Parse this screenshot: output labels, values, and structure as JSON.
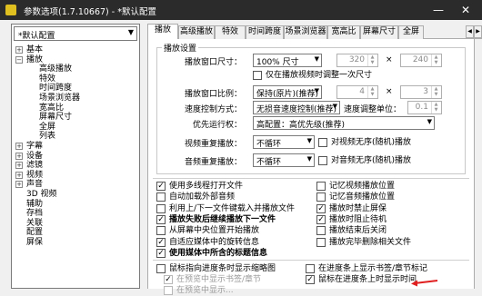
{
  "window": {
    "title": "参数选项(1.7.10667) - *默认配置",
    "min_icon": "minimize-icon",
    "close_icon": "close-icon",
    "min_glyph": "—",
    "close_glyph": "✕"
  },
  "profile": {
    "selected": "*默认配置",
    "arrow": "▼"
  },
  "tree": [
    {
      "label": "基本",
      "toggle": "+"
    },
    {
      "label": "播放",
      "toggle": "−"
    },
    {
      "label": "高级播放"
    },
    {
      "label": "特效"
    },
    {
      "label": "时间跨度"
    },
    {
      "label": "场景浏览器"
    },
    {
      "label": "宽高比"
    },
    {
      "label": "屏幕尺寸"
    },
    {
      "label": "全屏"
    },
    {
      "label": "列表"
    },
    {
      "label": "字幕",
      "toggle": "+"
    },
    {
      "label": "设备",
      "toggle": "+"
    },
    {
      "label": "滤镜",
      "toggle": "+"
    },
    {
      "label": "视频",
      "toggle": "+"
    },
    {
      "label": "声音",
      "toggle": "+"
    },
    {
      "label": "3D 视频"
    },
    {
      "label": "辅助"
    },
    {
      "label": "存档"
    },
    {
      "label": "关联"
    },
    {
      "label": "配置"
    },
    {
      "label": "屏保"
    }
  ],
  "tabs": [
    {
      "label": "播放",
      "active": true
    },
    {
      "label": "高级播放"
    },
    {
      "label": "特效"
    },
    {
      "label": "时间跨度"
    },
    {
      "label": "场景浏览器"
    },
    {
      "label": "宽高比"
    },
    {
      "label": "屏幕尺寸"
    },
    {
      "label": "全屏"
    }
  ],
  "tab_scroll": {
    "left": "◀",
    "right": "▶"
  },
  "group": {
    "title": "播放设置"
  },
  "settings": {
    "window_size": {
      "label": "播放窗口尺寸：",
      "value": "100% 尺寸",
      "w": "320",
      "h": "240",
      "sep": "×"
    },
    "only_first": {
      "label": "仅在播放视频时调整一次尺寸",
      "checked": false
    },
    "ratio": {
      "label": "播放窗口比例：",
      "value": "保持(原片)(推荐)",
      "a": "4",
      "b": "3",
      "sep": "×"
    },
    "speed_mode": {
      "label": "速度控制方式：",
      "value": "无损音速度控制(推荐)",
      "unit_label": "速度调整单位：",
      "unit_value": "0.1"
    },
    "priority": {
      "label": "优先运行权：",
      "value": "高配置：高优先级(推荐)"
    },
    "video_repeat": {
      "label": "视频重复播放：",
      "value": "不循环",
      "random_label": "对视频无序(随机)播放"
    },
    "audio_repeat": {
      "label": "音频重复播放：",
      "value": "不循环",
      "random_label": "对音频无序(随机)播放"
    }
  },
  "options_left": [
    {
      "label": "使用多线程打开文件",
      "checked": true
    },
    {
      "label": "自动加载外部音频",
      "checked": false
    },
    {
      "label": "利用上/下一文件键载入并播放文件",
      "checked": false
    },
    {
      "label": "播放失败后继续播放下一文件",
      "checked": true,
      "bold": true
    },
    {
      "label": "从屏幕中央位置开始播放",
      "checked": false
    },
    {
      "label": "自适应媒体中的旋转信息",
      "checked": true
    },
    {
      "label": "使用媒体中所含的标题信息",
      "checked": true,
      "bold": true
    }
  ],
  "options_right": [
    {
      "label": "记忆视频播放位置",
      "checked": false
    },
    {
      "label": "记忆音频播放位置",
      "checked": false
    },
    {
      "label": "播放时禁止屏保",
      "checked": true
    },
    {
      "label": "播放时阻止待机",
      "checked": true
    },
    {
      "label": "播放结束后关闭",
      "checked": false
    },
    {
      "label": "播放完毕删除相关文件",
      "checked": false
    }
  ],
  "options_bottom_left": [
    {
      "label": "鼠标指向进度条时显示缩略图",
      "checked": false
    },
    {
      "label": "在预览中显示书签/章节",
      "checked": true,
      "disabled": true
    },
    {
      "label": "在预览中显示...",
      "checked": false,
      "disabled": true
    }
  ],
  "options_bottom_right": [
    {
      "label": "在进度条上显示书签/章节标记",
      "checked": false
    },
    {
      "label": "鼠标在进度条上时显示时间",
      "checked": true
    }
  ],
  "check_glyph": "✓",
  "accent": {
    "titlebar": "#2b2b2b",
    "arrow": "#e02020"
  }
}
